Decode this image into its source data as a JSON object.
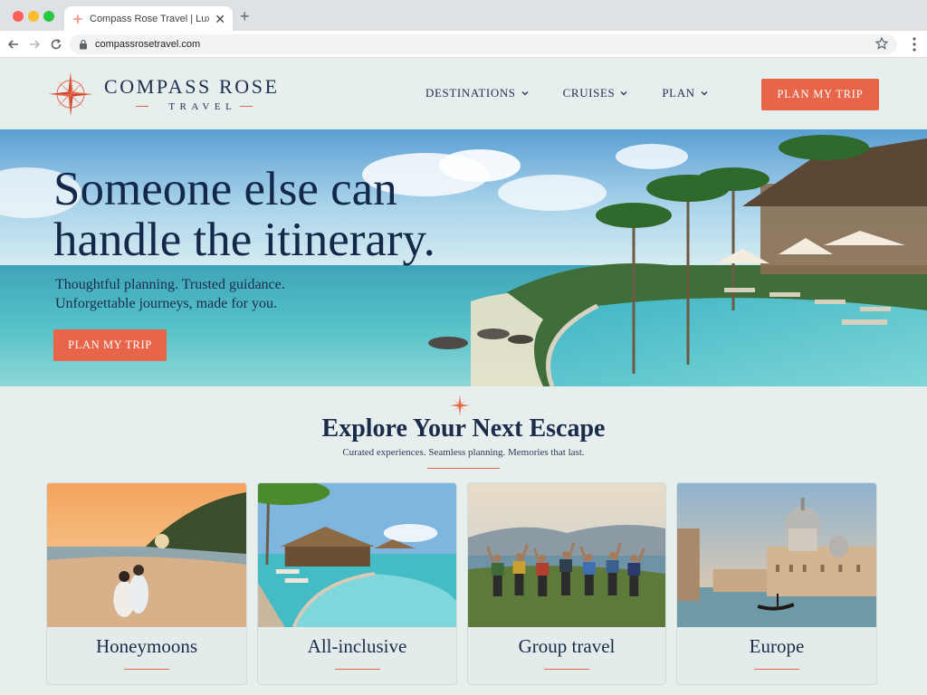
{
  "browser": {
    "tab_title": "Compass Rose Travel | Luxury Tr",
    "url": "compassrosetravel.com",
    "icons": [
      "back-icon",
      "forward-icon",
      "reload-icon",
      "lock-icon",
      "star-icon",
      "menu-icon",
      "close-icon",
      "plus-icon"
    ]
  },
  "header": {
    "logo_name": "COMPASS ROSE",
    "logo_sub": "TRAVEL",
    "nav": [
      {
        "label": "DESTINATIONS"
      },
      {
        "label": "CRUISES"
      },
      {
        "label": "PLAN"
      }
    ],
    "cta": "PLAN MY TRIP"
  },
  "hero": {
    "title_line1": "Someone else can",
    "title_line2": "handle the itinerary.",
    "subtitle_line1": "Thoughtful planning. Trusted guidance.",
    "subtitle_line2": "Unforgettable journeys, made for you.",
    "cta": "PLAN MY TRIP"
  },
  "explore": {
    "title": "Explore Your Next Escape",
    "subtitle": "Curated experiences. Seamless planning. Memories that last.",
    "cards": [
      {
        "label": "Honeymoons"
      },
      {
        "label": "All-inclusive"
      },
      {
        "label": "Group travel"
      },
      {
        "label": "Europe"
      }
    ]
  },
  "colors": {
    "accent": "#e8654a",
    "navy": "#1a2c4a",
    "background": "#e7efee"
  }
}
